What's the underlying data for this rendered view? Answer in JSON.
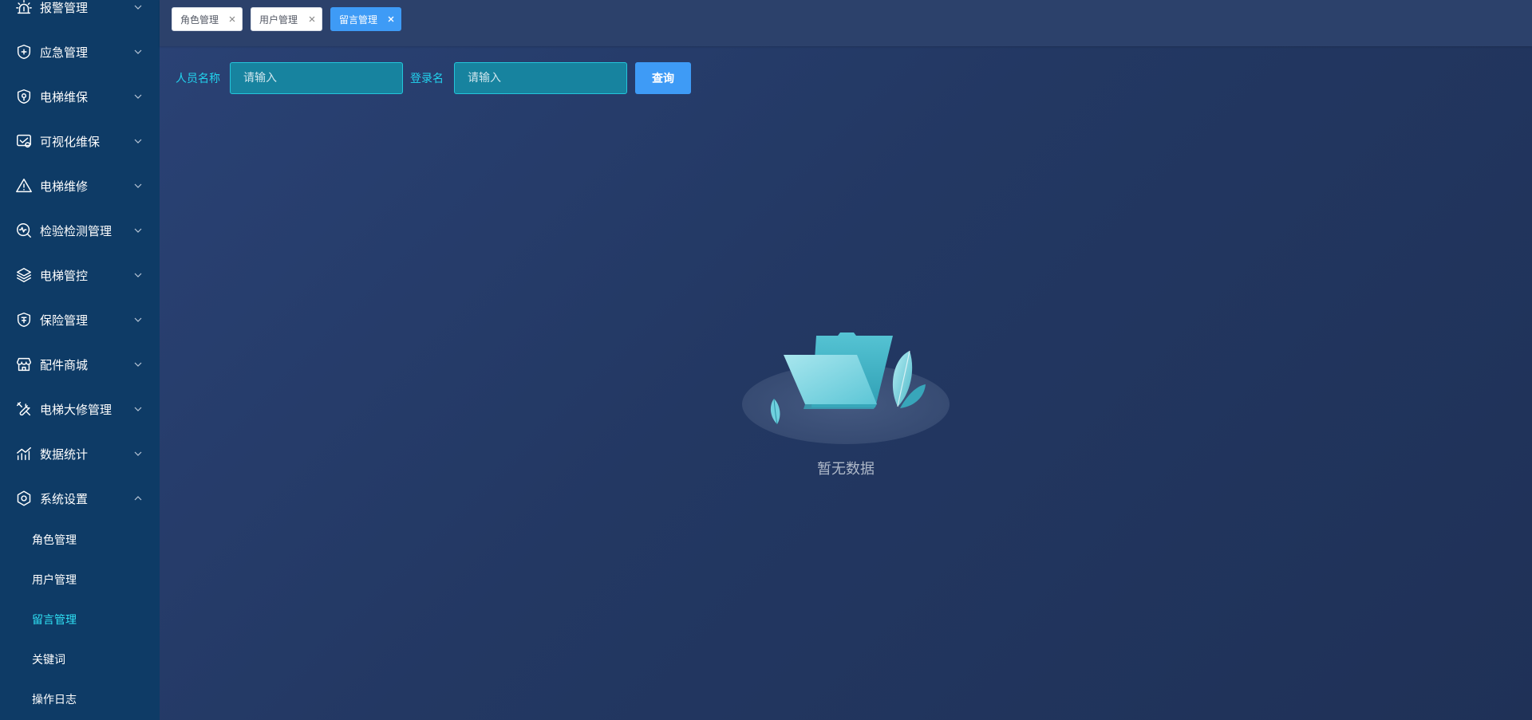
{
  "sidebar": {
    "menu": [
      {
        "label": "报警管理",
        "icon": "alarm-icon"
      },
      {
        "label": "应急管理",
        "icon": "shield-plus-icon"
      },
      {
        "label": "电梯维保",
        "icon": "shield-wrench-icon"
      },
      {
        "label": "可视化维保",
        "icon": "monitor-check-icon"
      },
      {
        "label": "电梯维修",
        "icon": "warning-icon"
      },
      {
        "label": "检验检测管理",
        "icon": "search-pulse-icon"
      },
      {
        "label": "电梯管控",
        "icon": "layers-icon"
      },
      {
        "label": "保险管理",
        "icon": "insurance-shield-icon"
      },
      {
        "label": "配件商城",
        "icon": "store-icon"
      },
      {
        "label": "电梯大修管理",
        "icon": "tools-icon"
      },
      {
        "label": "数据统计",
        "icon": "chart-icon"
      },
      {
        "label": "系统设置",
        "icon": "settings-icon"
      }
    ],
    "submenu": [
      {
        "label": "角色管理"
      },
      {
        "label": "用户管理"
      },
      {
        "label": "留言管理"
      },
      {
        "label": "关键词"
      },
      {
        "label": "操作日志"
      }
    ]
  },
  "tabs": [
    {
      "label": "角色管理"
    },
    {
      "label": "用户管理"
    },
    {
      "label": "留言管理"
    }
  ],
  "search": {
    "name_label": "人员名称",
    "name_placeholder": "请输入",
    "login_label": "登录名",
    "login_placeholder": "请输入",
    "query_label": "查询"
  },
  "empty": {
    "text": "暂无数据"
  },
  "colors": {
    "sidebar_bg": "#0e3b66",
    "main_bg": "#23375f",
    "accent": "#3e9bf6",
    "cyan_text": "#22d3ee",
    "input_bg": "#17839f",
    "active_submenu": "#2fe0f4"
  }
}
